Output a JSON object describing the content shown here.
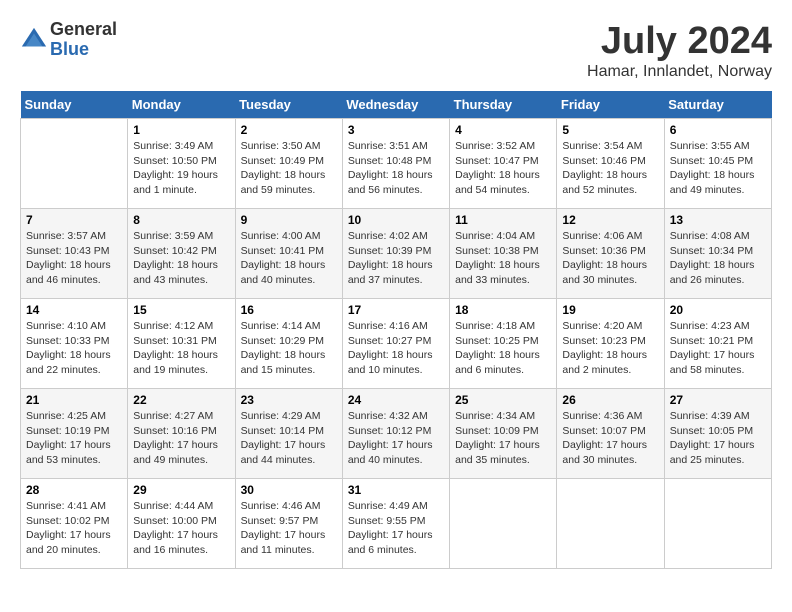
{
  "header": {
    "logo": {
      "general": "General",
      "blue": "Blue"
    },
    "month": "July 2024",
    "location": "Hamar, Innlandet, Norway"
  },
  "weekdays": [
    "Sunday",
    "Monday",
    "Tuesday",
    "Wednesday",
    "Thursday",
    "Friday",
    "Saturday"
  ],
  "weeks": [
    [
      {
        "day": "",
        "sunrise": "",
        "sunset": "",
        "daylight": ""
      },
      {
        "day": "1",
        "sunrise": "Sunrise: 3:49 AM",
        "sunset": "Sunset: 10:50 PM",
        "daylight": "Daylight: 19 hours and 1 minute."
      },
      {
        "day": "2",
        "sunrise": "Sunrise: 3:50 AM",
        "sunset": "Sunset: 10:49 PM",
        "daylight": "Daylight: 18 hours and 59 minutes."
      },
      {
        "day": "3",
        "sunrise": "Sunrise: 3:51 AM",
        "sunset": "Sunset: 10:48 PM",
        "daylight": "Daylight: 18 hours and 56 minutes."
      },
      {
        "day": "4",
        "sunrise": "Sunrise: 3:52 AM",
        "sunset": "Sunset: 10:47 PM",
        "daylight": "Daylight: 18 hours and 54 minutes."
      },
      {
        "day": "5",
        "sunrise": "Sunrise: 3:54 AM",
        "sunset": "Sunset: 10:46 PM",
        "daylight": "Daylight: 18 hours and 52 minutes."
      },
      {
        "day": "6",
        "sunrise": "Sunrise: 3:55 AM",
        "sunset": "Sunset: 10:45 PM",
        "daylight": "Daylight: 18 hours and 49 minutes."
      }
    ],
    [
      {
        "day": "7",
        "sunrise": "Sunrise: 3:57 AM",
        "sunset": "Sunset: 10:43 PM",
        "daylight": "Daylight: 18 hours and 46 minutes."
      },
      {
        "day": "8",
        "sunrise": "Sunrise: 3:59 AM",
        "sunset": "Sunset: 10:42 PM",
        "daylight": "Daylight: 18 hours and 43 minutes."
      },
      {
        "day": "9",
        "sunrise": "Sunrise: 4:00 AM",
        "sunset": "Sunset: 10:41 PM",
        "daylight": "Daylight: 18 hours and 40 minutes."
      },
      {
        "day": "10",
        "sunrise": "Sunrise: 4:02 AM",
        "sunset": "Sunset: 10:39 PM",
        "daylight": "Daylight: 18 hours and 37 minutes."
      },
      {
        "day": "11",
        "sunrise": "Sunrise: 4:04 AM",
        "sunset": "Sunset: 10:38 PM",
        "daylight": "Daylight: 18 hours and 33 minutes."
      },
      {
        "day": "12",
        "sunrise": "Sunrise: 4:06 AM",
        "sunset": "Sunset: 10:36 PM",
        "daylight": "Daylight: 18 hours and 30 minutes."
      },
      {
        "day": "13",
        "sunrise": "Sunrise: 4:08 AM",
        "sunset": "Sunset: 10:34 PM",
        "daylight": "Daylight: 18 hours and 26 minutes."
      }
    ],
    [
      {
        "day": "14",
        "sunrise": "Sunrise: 4:10 AM",
        "sunset": "Sunset: 10:33 PM",
        "daylight": "Daylight: 18 hours and 22 minutes."
      },
      {
        "day": "15",
        "sunrise": "Sunrise: 4:12 AM",
        "sunset": "Sunset: 10:31 PM",
        "daylight": "Daylight: 18 hours and 19 minutes."
      },
      {
        "day": "16",
        "sunrise": "Sunrise: 4:14 AM",
        "sunset": "Sunset: 10:29 PM",
        "daylight": "Daylight: 18 hours and 15 minutes."
      },
      {
        "day": "17",
        "sunrise": "Sunrise: 4:16 AM",
        "sunset": "Sunset: 10:27 PM",
        "daylight": "Daylight: 18 hours and 10 minutes."
      },
      {
        "day": "18",
        "sunrise": "Sunrise: 4:18 AM",
        "sunset": "Sunset: 10:25 PM",
        "daylight": "Daylight: 18 hours and 6 minutes."
      },
      {
        "day": "19",
        "sunrise": "Sunrise: 4:20 AM",
        "sunset": "Sunset: 10:23 PM",
        "daylight": "Daylight: 18 hours and 2 minutes."
      },
      {
        "day": "20",
        "sunrise": "Sunrise: 4:23 AM",
        "sunset": "Sunset: 10:21 PM",
        "daylight": "Daylight: 17 hours and 58 minutes."
      }
    ],
    [
      {
        "day": "21",
        "sunrise": "Sunrise: 4:25 AM",
        "sunset": "Sunset: 10:19 PM",
        "daylight": "Daylight: 17 hours and 53 minutes."
      },
      {
        "day": "22",
        "sunrise": "Sunrise: 4:27 AM",
        "sunset": "Sunset: 10:16 PM",
        "daylight": "Daylight: 17 hours and 49 minutes."
      },
      {
        "day": "23",
        "sunrise": "Sunrise: 4:29 AM",
        "sunset": "Sunset: 10:14 PM",
        "daylight": "Daylight: 17 hours and 44 minutes."
      },
      {
        "day": "24",
        "sunrise": "Sunrise: 4:32 AM",
        "sunset": "Sunset: 10:12 PM",
        "daylight": "Daylight: 17 hours and 40 minutes."
      },
      {
        "day": "25",
        "sunrise": "Sunrise: 4:34 AM",
        "sunset": "Sunset: 10:09 PM",
        "daylight": "Daylight: 17 hours and 35 minutes."
      },
      {
        "day": "26",
        "sunrise": "Sunrise: 4:36 AM",
        "sunset": "Sunset: 10:07 PM",
        "daylight": "Daylight: 17 hours and 30 minutes."
      },
      {
        "day": "27",
        "sunrise": "Sunrise: 4:39 AM",
        "sunset": "Sunset: 10:05 PM",
        "daylight": "Daylight: 17 hours and 25 minutes."
      }
    ],
    [
      {
        "day": "28",
        "sunrise": "Sunrise: 4:41 AM",
        "sunset": "Sunset: 10:02 PM",
        "daylight": "Daylight: 17 hours and 20 minutes."
      },
      {
        "day": "29",
        "sunrise": "Sunrise: 4:44 AM",
        "sunset": "Sunset: 10:00 PM",
        "daylight": "Daylight: 17 hours and 16 minutes."
      },
      {
        "day": "30",
        "sunrise": "Sunrise: 4:46 AM",
        "sunset": "Sunset: 9:57 PM",
        "daylight": "Daylight: 17 hours and 11 minutes."
      },
      {
        "day": "31",
        "sunrise": "Sunrise: 4:49 AM",
        "sunset": "Sunset: 9:55 PM",
        "daylight": "Daylight: 17 hours and 6 minutes."
      },
      {
        "day": "",
        "sunrise": "",
        "sunset": "",
        "daylight": ""
      },
      {
        "day": "",
        "sunrise": "",
        "sunset": "",
        "daylight": ""
      },
      {
        "day": "",
        "sunrise": "",
        "sunset": "",
        "daylight": ""
      }
    ]
  ]
}
